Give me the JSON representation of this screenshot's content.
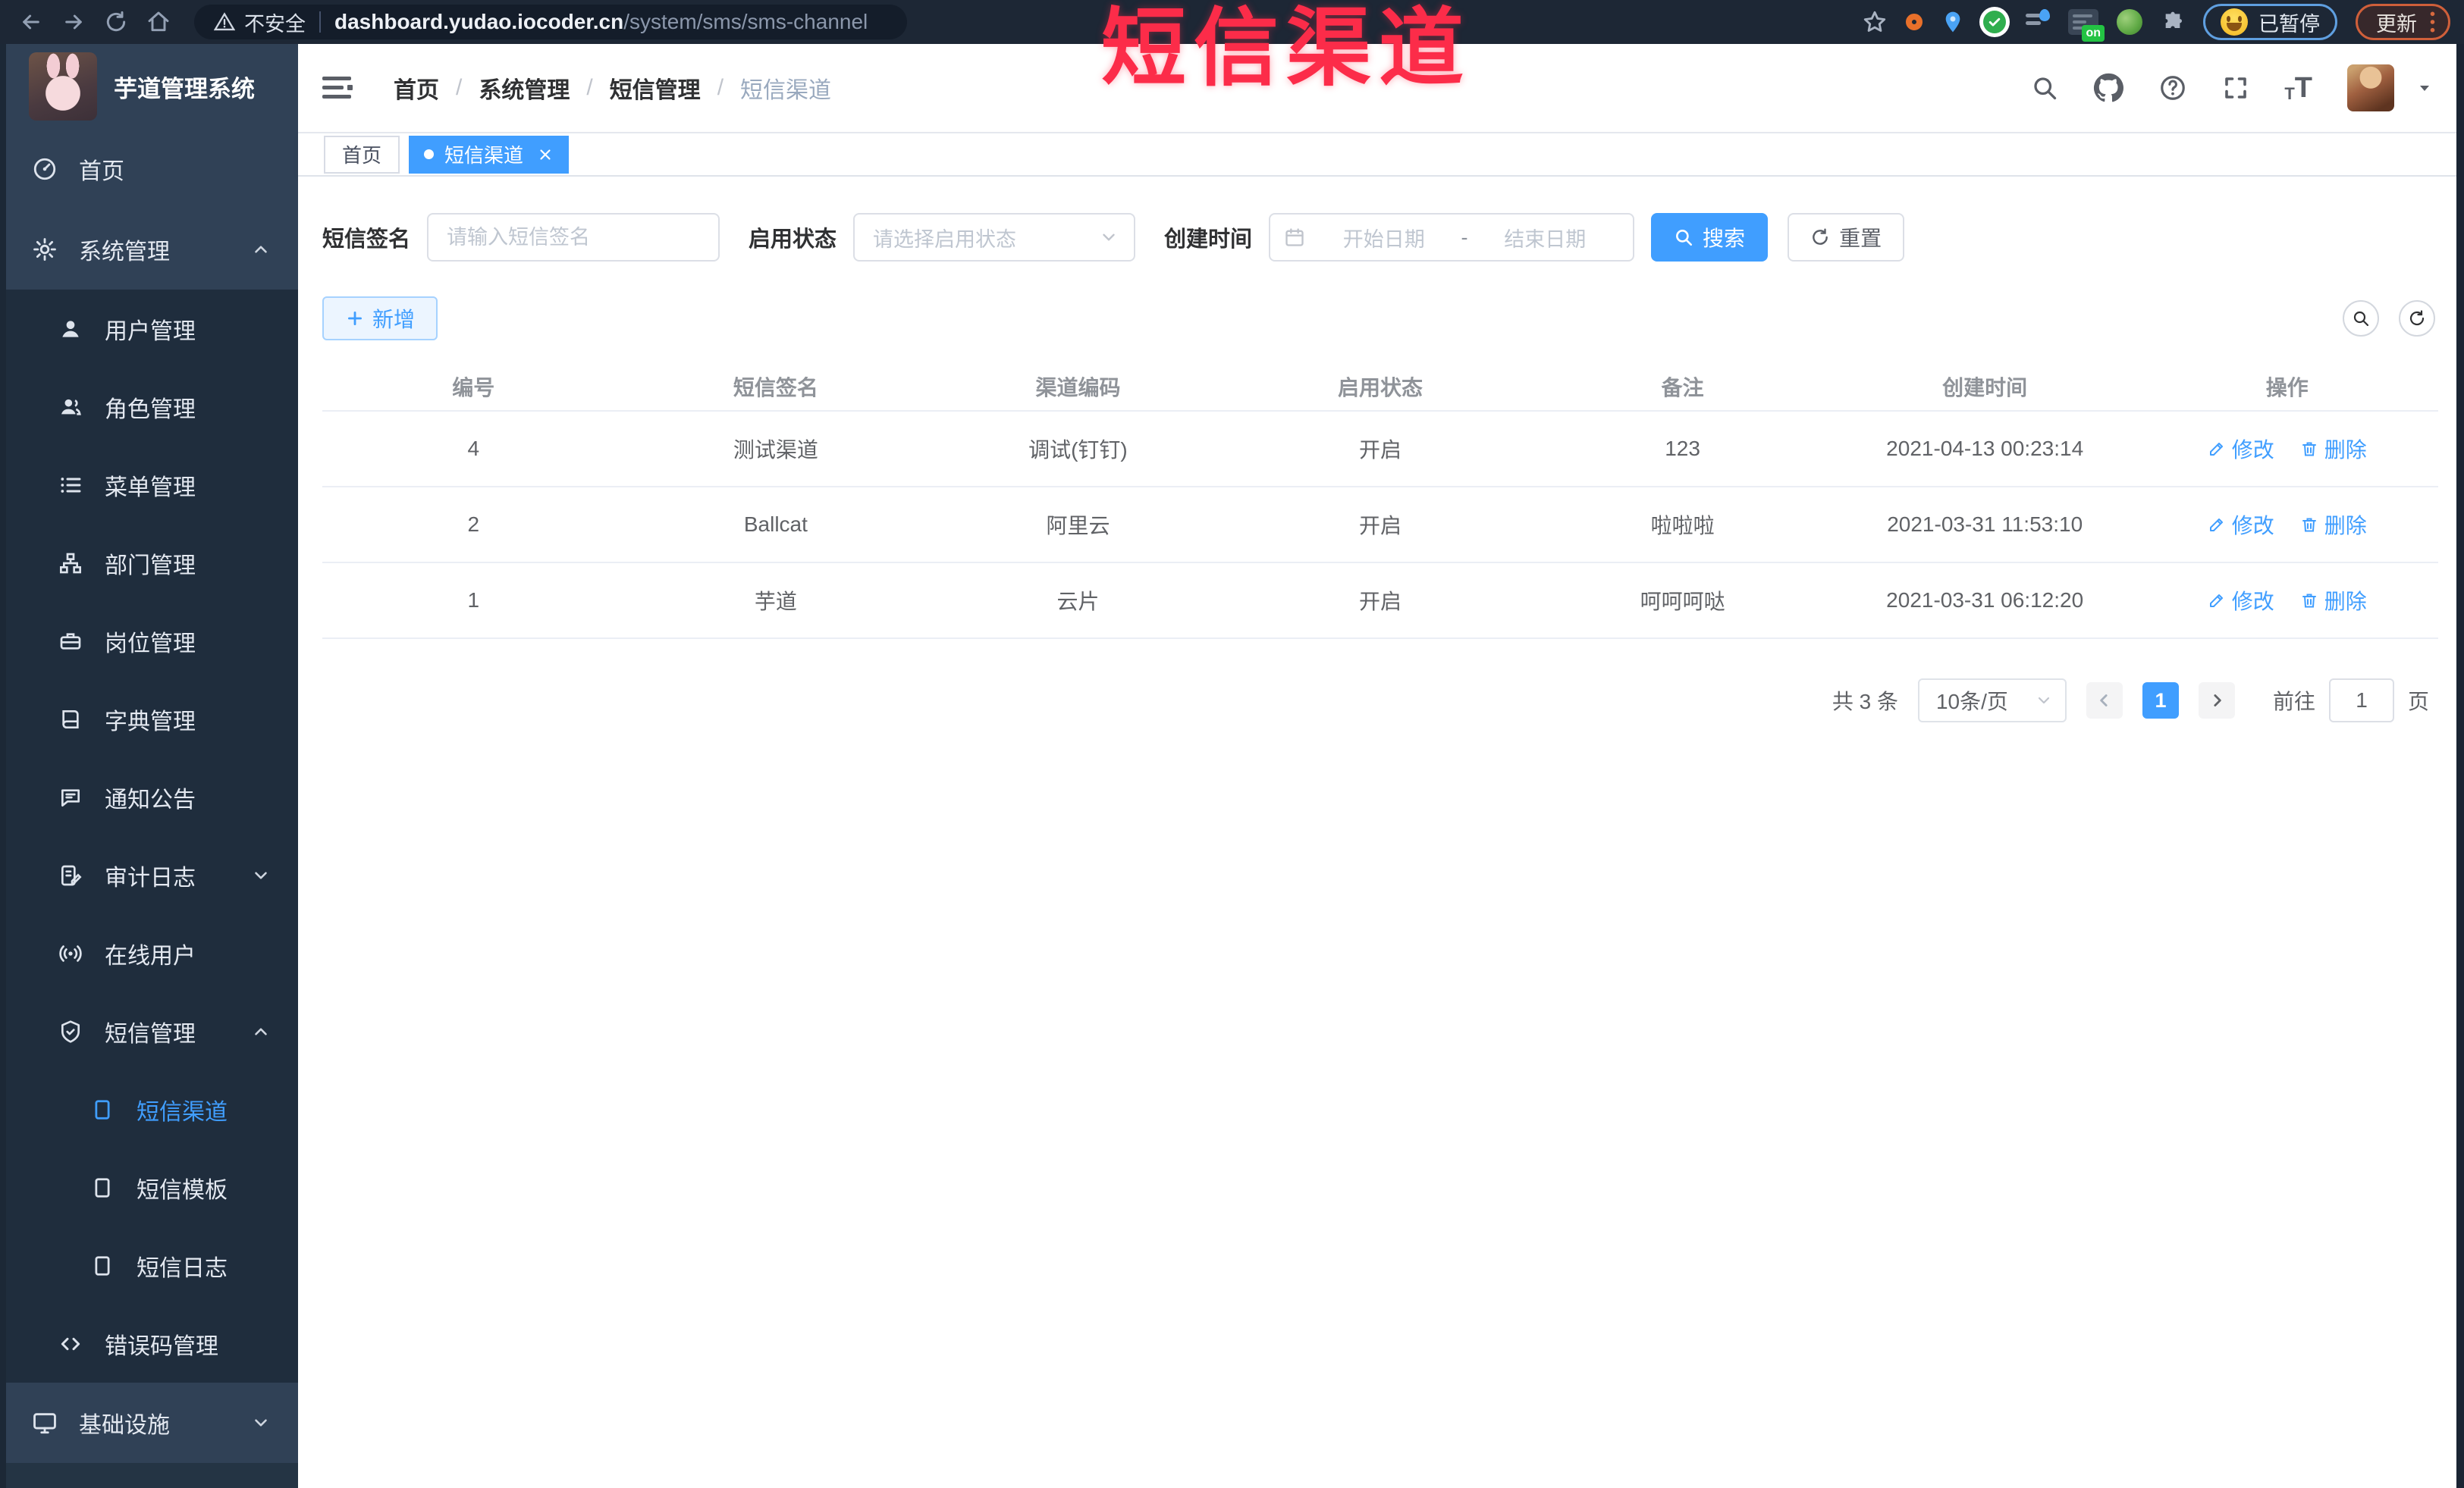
{
  "theme": {
    "primary": "#409eff",
    "sidebar_bg": "#304156",
    "submenu_bg": "#1f2d3d",
    "chrome_bg": "#1d2735",
    "overlay_red": "#fc2c49"
  },
  "browser": {
    "security_label": "不安全",
    "url_host": "dashboard.yudao.iocoder.cn",
    "url_path": "/system/sms/sms-channel",
    "extension_badge": "on",
    "paused_badge": "已暂停",
    "update_label": "更新"
  },
  "overlay": {
    "title": "短信渠道"
  },
  "sidebar": {
    "logo_title": "芋道管理系统",
    "items": [
      {
        "label": "首页"
      },
      {
        "label": "系统管理"
      },
      {
        "label": "用户管理"
      },
      {
        "label": "角色管理"
      },
      {
        "label": "菜单管理"
      },
      {
        "label": "部门管理"
      },
      {
        "label": "岗位管理"
      },
      {
        "label": "字典管理"
      },
      {
        "label": "通知公告"
      },
      {
        "label": "审计日志"
      },
      {
        "label": "在线用户"
      },
      {
        "label": "短信管理"
      },
      {
        "label": "短信渠道"
      },
      {
        "label": "短信模板"
      },
      {
        "label": "短信日志"
      },
      {
        "label": "错误码管理"
      },
      {
        "label": "基础设施"
      }
    ]
  },
  "header": {
    "breadcrumbs": [
      "首页",
      "系统管理",
      "短信管理",
      "短信渠道"
    ]
  },
  "tags": {
    "home": "首页",
    "active": "短信渠道"
  },
  "filters": {
    "sign_label": "短信签名",
    "sign_placeholder": "请输入短信签名",
    "status_label": "启用状态",
    "status_placeholder": "请选择启用状态",
    "time_label": "创建时间",
    "start_placeholder": "开始日期",
    "range_separator": "-",
    "end_placeholder": "结束日期",
    "search_label": "搜索",
    "reset_label": "重置"
  },
  "toolbar": {
    "add_label": "新增"
  },
  "table": {
    "headers": [
      "编号",
      "短信签名",
      "渠道编码",
      "启用状态",
      "备注",
      "创建时间",
      "操作"
    ],
    "rows": [
      {
        "id": "4",
        "sign": "测试渠道",
        "code": "调试(钉钉)",
        "status": "开启",
        "remark": "123",
        "created": "2021-04-13 00:23:14"
      },
      {
        "id": "2",
        "sign": "Ballcat",
        "code": "阿里云",
        "status": "开启",
        "remark": "啦啦啦",
        "created": "2021-03-31 11:53:10"
      },
      {
        "id": "1",
        "sign": "芋道",
        "code": "云片",
        "status": "开启",
        "remark": "呵呵呵哒",
        "created": "2021-03-31 06:12:20"
      }
    ],
    "actions": {
      "edit": "修改",
      "delete": "删除"
    }
  },
  "pagination": {
    "total_label": "共 3 条",
    "size_label": "10条/页",
    "current_page": "1",
    "goto_label": "前往",
    "goto_value": "1",
    "page_unit": "页"
  }
}
